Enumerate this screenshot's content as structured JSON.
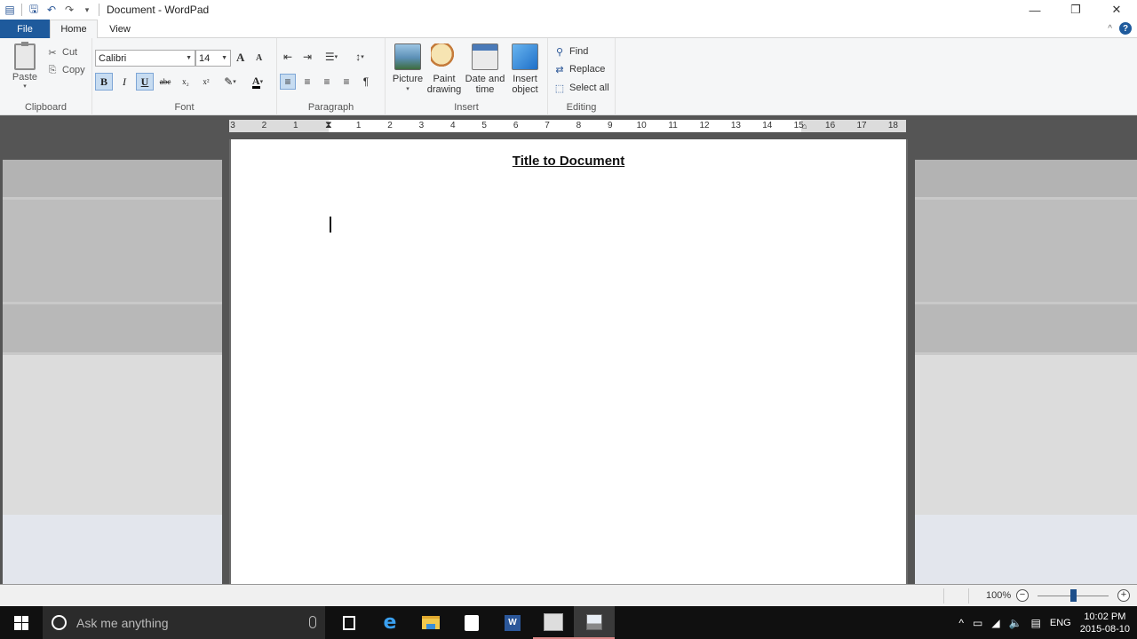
{
  "window": {
    "title": "Document - WordPad",
    "controls": {
      "minimize": "—",
      "restore": "❐",
      "close": "✕"
    }
  },
  "quick_access": {
    "app_icon": "wordpad-icon",
    "save": "save-icon",
    "undo": "undo-icon",
    "redo": "redo-icon",
    "customize": "▾"
  },
  "tabs": [
    {
      "label": "File"
    },
    {
      "label": "Home"
    },
    {
      "label": "View"
    }
  ],
  "ribbon": {
    "collapse_glyph": "^",
    "help_glyph": "?",
    "clipboard": {
      "label": "Clipboard",
      "paste": "Paste",
      "cut": "Cut",
      "copy": "Copy"
    },
    "font": {
      "label": "Font",
      "family": "Calibri",
      "size": "14",
      "grow_glyph": "A",
      "shrink_glyph": "A",
      "bold": "B",
      "italic": "I",
      "underline": "U",
      "strike": "abc",
      "subscript": "x₂",
      "superscript": "x²",
      "highlight_glyph": "✎",
      "color_glyph": "A"
    },
    "paragraph": {
      "label": "Paragraph",
      "decrease_indent": "⇤",
      "increase_indent": "⇥",
      "bullets": "☰",
      "line_spacing": "↕",
      "align_left": "≡",
      "align_center": "≡",
      "align_right": "≡",
      "justify": "≡",
      "paragraph_settings": "¶"
    },
    "insert": {
      "label": "Insert",
      "picture": "Picture",
      "paint_line1": "Paint",
      "paint_line2": "drawing",
      "date_line1": "Date and",
      "date_line2": "time",
      "object_line1": "Insert",
      "object_line2": "object"
    },
    "editing": {
      "label": "Editing",
      "find": "Find",
      "replace": "Replace",
      "select_all": "Select all"
    }
  },
  "ruler": {
    "labels": [
      "3",
      "2",
      "1",
      "",
      "1",
      "2",
      "3",
      "4",
      "5",
      "6",
      "7",
      "8",
      "9",
      "10",
      "11",
      "12",
      "13",
      "14",
      "15",
      "16",
      "17",
      "18"
    ]
  },
  "document": {
    "title": "Title to Document"
  },
  "status": {
    "zoom": "100%",
    "zoom_out": "−",
    "zoom_in": "+",
    "zoom_slider_fraction": 0.5
  },
  "taskbar": {
    "search_placeholder": "Ask me anything",
    "word_label": "W",
    "tray": {
      "language": "ENG",
      "time": "10:02 PM",
      "date": "2015-08-10",
      "chevron": "^",
      "battery": "▭",
      "wifi": "◢",
      "volume": "🔈",
      "notifications": "▤"
    }
  }
}
